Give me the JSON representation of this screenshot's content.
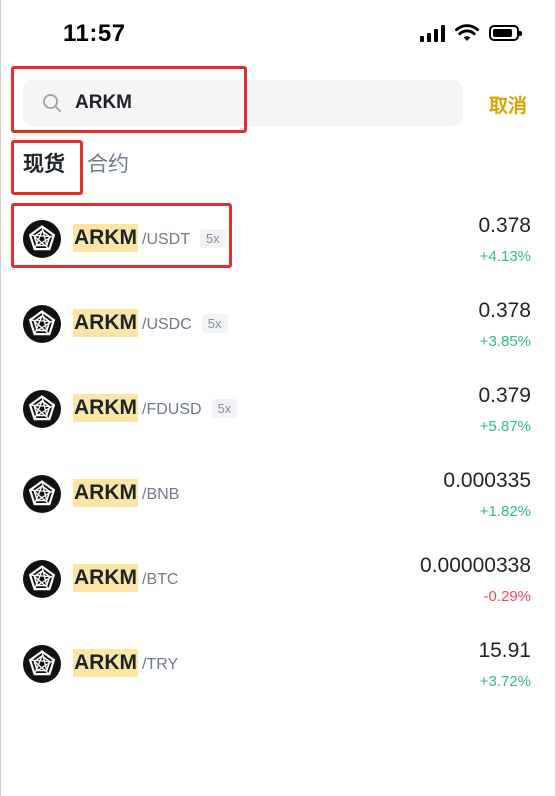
{
  "status_bar": {
    "time": "11:57"
  },
  "search": {
    "value": "ARKM",
    "placeholder": ""
  },
  "cancel_label": "取消",
  "tabs": [
    {
      "label": "现货",
      "active": true
    },
    {
      "label": "合约",
      "active": false
    }
  ],
  "colors": {
    "accent": "#d9a400",
    "up": "#2ebd85",
    "down": "#f6465d",
    "highlight": "#fbe6a6",
    "annotation": "#e03131"
  },
  "pairs": [
    {
      "base": "ARKM",
      "quote": "/USDT",
      "leverage": "5x",
      "price": "0.378",
      "change": "+4.13%",
      "direction": "up"
    },
    {
      "base": "ARKM",
      "quote": "/USDC",
      "leverage": "5x",
      "price": "0.378",
      "change": "+3.85%",
      "direction": "up"
    },
    {
      "base": "ARKM",
      "quote": "/FDUSD",
      "leverage": "5x",
      "price": "0.379",
      "change": "+5.87%",
      "direction": "up"
    },
    {
      "base": "ARKM",
      "quote": "/BNB",
      "leverage": "",
      "price": "0.000335",
      "change": "+1.82%",
      "direction": "up"
    },
    {
      "base": "ARKM",
      "quote": "/BTC",
      "leverage": "",
      "price": "0.00000338",
      "change": "-0.29%",
      "direction": "down"
    },
    {
      "base": "ARKM",
      "quote": "/TRY",
      "leverage": "",
      "price": "15.91",
      "change": "+3.72%",
      "direction": "up"
    }
  ],
  "icons": {
    "search": "search-icon",
    "coin": "arkm-coin-icon",
    "signal": "cellular-signal-icon",
    "wifi": "wifi-icon",
    "battery": "battery-icon"
  }
}
